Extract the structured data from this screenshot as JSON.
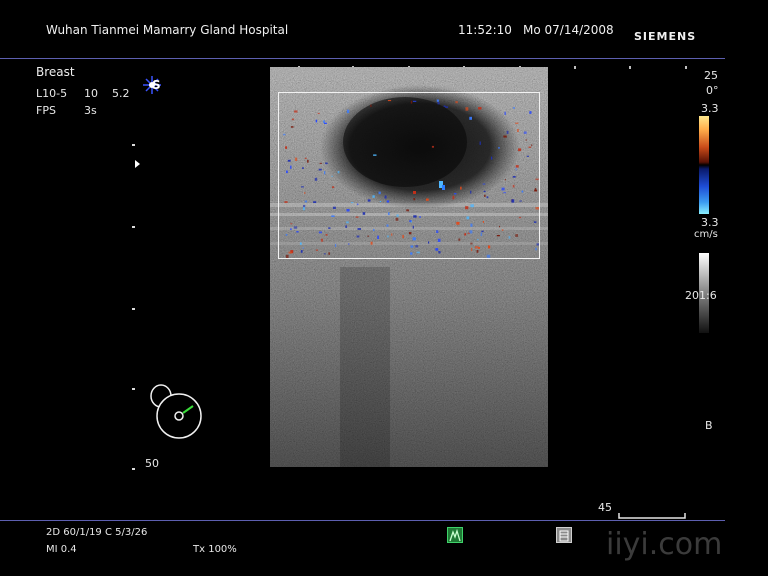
{
  "header": {
    "hospital": "Wuhan Tianmei Mamarry Gland Hospital",
    "time": "11:52:10",
    "date": "Mo 07/14/2008",
    "brand": "SIEMENS"
  },
  "left_panel": {
    "preset": "Breast",
    "transducer": "L10-5",
    "freq_a": "10",
    "freq_b": "5.2",
    "fps_label": "FPS",
    "fps_value": "3s",
    "probe_icon_letter": "S",
    "depth_value": "50"
  },
  "right_panel": {
    "top_value": "25",
    "angle": "0°",
    "color_top": "3.3",
    "color_bottom": "3.3",
    "color_unit": "cm/s",
    "dynamic_range": "201:6",
    "mode_letter": "B",
    "scale_value": "45"
  },
  "footer": {
    "mode_params": "2D  60/1/19   C 5/3/26",
    "mi": "MI 0.4",
    "tx": "Tx     100%",
    "watermark": "iiyi.com"
  },
  "colors": {
    "divider": "#5d5fb0",
    "background": "#000000",
    "footer_icon_green": "#1f7a35",
    "footer_icon_gray": "#8a8a8a"
  }
}
